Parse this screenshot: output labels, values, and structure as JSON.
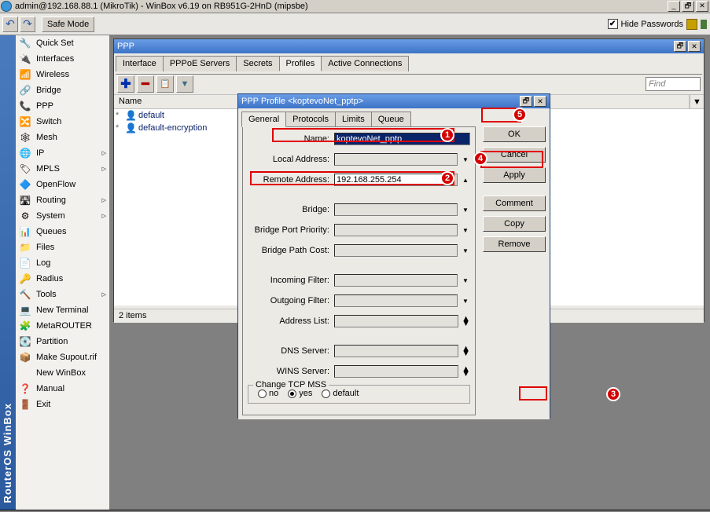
{
  "title": "admin@192.168.88.1 (MikroTik) - WinBox v6.19 on RB951G-2HnD (mipsbe)",
  "toolbar": {
    "safe_mode": "Safe Mode",
    "hide_passwords": "Hide Passwords"
  },
  "sidebar_label": "RouterOS WinBox",
  "menu": [
    {
      "label": "Quick Set",
      "icon": "🔧",
      "arrow": false
    },
    {
      "label": "Interfaces",
      "icon": "🔌",
      "arrow": false
    },
    {
      "label": "Wireless",
      "icon": "📶",
      "arrow": false
    },
    {
      "label": "Bridge",
      "icon": "🔗",
      "arrow": false
    },
    {
      "label": "PPP",
      "icon": "📞",
      "arrow": false
    },
    {
      "label": "Switch",
      "icon": "🔀",
      "arrow": false
    },
    {
      "label": "Mesh",
      "icon": "🕸",
      "arrow": false
    },
    {
      "label": "IP",
      "icon": "🌐",
      "arrow": true
    },
    {
      "label": "MPLS",
      "icon": "🏷",
      "arrow": true
    },
    {
      "label": "OpenFlow",
      "icon": "🔷",
      "arrow": false
    },
    {
      "label": "Routing",
      "icon": "🛣",
      "arrow": true
    },
    {
      "label": "System",
      "icon": "⚙",
      "arrow": true
    },
    {
      "label": "Queues",
      "icon": "📊",
      "arrow": false
    },
    {
      "label": "Files",
      "icon": "📁",
      "arrow": false
    },
    {
      "label": "Log",
      "icon": "📄",
      "arrow": false
    },
    {
      "label": "Radius",
      "icon": "🔑",
      "arrow": false
    },
    {
      "label": "Tools",
      "icon": "🔨",
      "arrow": true
    },
    {
      "label": "New Terminal",
      "icon": "💻",
      "arrow": false
    },
    {
      "label": "MetaROUTER",
      "icon": "🧩",
      "arrow": false
    },
    {
      "label": "Partition",
      "icon": "💽",
      "arrow": false
    },
    {
      "label": "Make Supout.rif",
      "icon": "📦",
      "arrow": false
    },
    {
      "label": "New WinBox",
      "icon": "",
      "arrow": false
    },
    {
      "label": "Manual",
      "icon": "❓",
      "arrow": false
    },
    {
      "label": "Exit",
      "icon": "🚪",
      "arrow": false
    }
  ],
  "ppp": {
    "title": "PPP",
    "tabs": [
      "Interface",
      "PPPoE Servers",
      "Secrets",
      "Profiles",
      "Active Connections"
    ],
    "active_tab": 3,
    "find": "Find",
    "col": "Name",
    "rows": [
      {
        "name": "default"
      },
      {
        "name": "default-encryption"
      }
    ],
    "status": "2 items"
  },
  "dlg": {
    "title": "PPP Profile <koptevoNet_pptp>",
    "tabs": [
      "General",
      "Protocols",
      "Limits",
      "Queue"
    ],
    "active_tab": 0,
    "buttons": [
      "OK",
      "Cancel",
      "Apply",
      "Comment",
      "Copy",
      "Remove"
    ],
    "fields": {
      "name": {
        "label": "Name:",
        "value": "koptevoNet_pptp"
      },
      "local_addr": {
        "label": "Local Address:"
      },
      "remote_addr": {
        "label": "Remote Address:",
        "value": "192.168.255.254"
      },
      "bridge": {
        "label": "Bridge:"
      },
      "bridge_port_pri": {
        "label": "Bridge Port Priority:"
      },
      "bridge_path_cost": {
        "label": "Bridge Path Cost:"
      },
      "in_filter": {
        "label": "Incoming Filter:"
      },
      "out_filter": {
        "label": "Outgoing Filter:"
      },
      "addr_list": {
        "label": "Address List:"
      },
      "dns": {
        "label": "DNS Server:"
      },
      "wins": {
        "label": "WINS Server:"
      }
    },
    "mss": {
      "legend": "Change TCP MSS",
      "options": [
        "no",
        "yes",
        "default"
      ],
      "selected": 1
    }
  },
  "badges": {
    "1": "1",
    "2": "2",
    "3": "3",
    "4": "4",
    "5": "5"
  }
}
